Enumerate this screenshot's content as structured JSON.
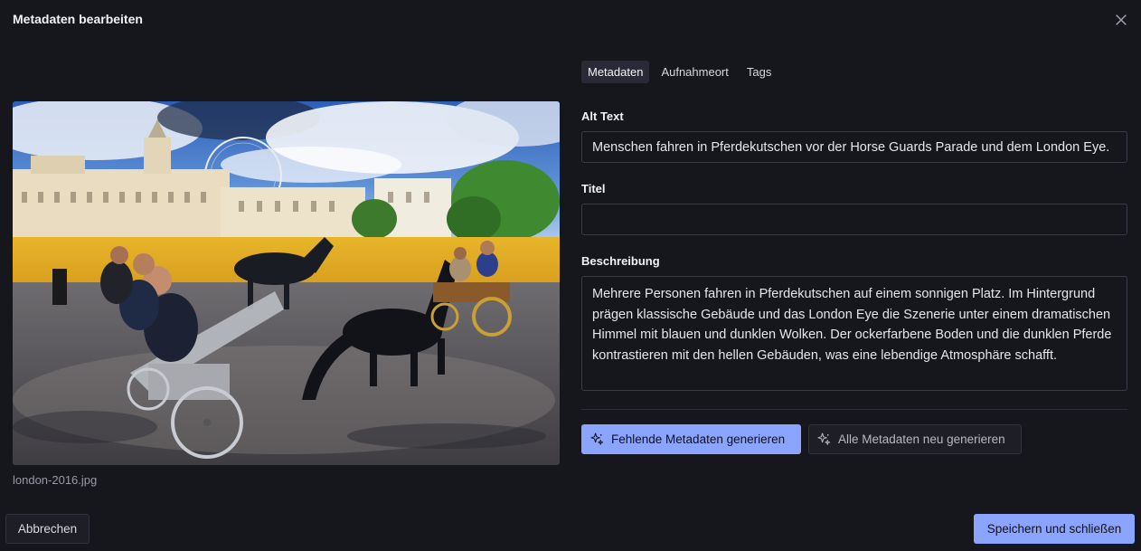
{
  "dialog": {
    "title": "Metadaten bearbeiten",
    "close_icon": "close-icon"
  },
  "image": {
    "filename": "london-2016.jpg"
  },
  "tabs": [
    {
      "label": "Metadaten",
      "active": true
    },
    {
      "label": "Aufnahmeort",
      "active": false
    },
    {
      "label": "Tags",
      "active": false
    }
  ],
  "fields": {
    "alt_text": {
      "label": "Alt Text",
      "value": "Menschen fahren in Pferdekutschen vor der Horse Guards Parade und dem London Eye."
    },
    "title": {
      "label": "Titel",
      "value": ""
    },
    "description": {
      "label": "Beschreibung",
      "value": "Mehrere Personen fahren in Pferdekutschen auf einem sonnigen Platz. Im Hintergrund prägen klassische Gebäude und das London Eye die Szenerie unter einem dramatischen Himmel mit blauen und dunklen Wolken. Der ockerfarbene Boden und die dunklen Pferde kontrastieren mit den hellen Gebäuden, was eine lebendige Atmosphäre schafft."
    }
  },
  "actions": {
    "generate_missing": "Fehlende Metadaten generieren",
    "regenerate_all": "Alle Metadaten neu generieren",
    "cancel": "Abbrechen",
    "save": "Speichern und schließen"
  },
  "colors": {
    "background": "#16161d",
    "accent": "#8aa4ff",
    "border": "#3a3a46"
  }
}
